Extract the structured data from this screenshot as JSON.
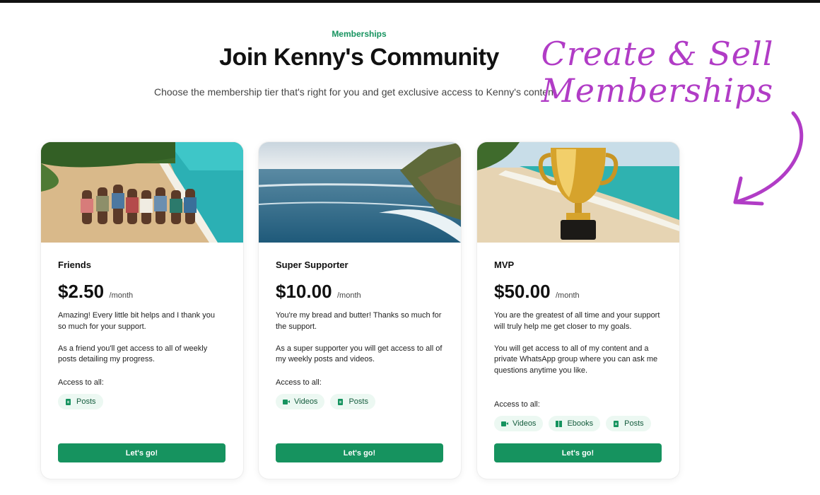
{
  "header": {
    "eyebrow": "Memberships",
    "title": "Join Kenny's Community",
    "subtitle": "Choose the membership tier that's right for you and get exclusive access to Kenny's content"
  },
  "promo": {
    "line1": "Create & Sell",
    "line2": "Memberships",
    "color": "#b13cc6"
  },
  "colors": {
    "accent": "#16935f",
    "chip_bg": "#ecf8f2",
    "chip_text": "#145c3d"
  },
  "tiers": [
    {
      "name": "Friends",
      "price": "$2.50",
      "period": "/month",
      "description": [
        "Amazing! Every little bit helps and I thank you so much for your support.",
        "As a friend you'll get access to all of weekly posts detailing my progress."
      ],
      "access_label": "Access to all:",
      "chips": [
        {
          "label": "Posts",
          "icon": "document-icon"
        }
      ],
      "cta": "Let's go!",
      "image": "group-of-friends-on-beach"
    },
    {
      "name": "Super Supporter",
      "price": "$10.00",
      "period": "/month",
      "description": [
        "You're my bread and butter! Thanks so much for the support.",
        "As a super supporter you will get access to all of my weekly posts and videos."
      ],
      "access_label": "Access to all:",
      "chips": [
        {
          "label": "Videos",
          "icon": "video-icon"
        },
        {
          "label": "Posts",
          "icon": "document-icon"
        }
      ],
      "cta": "Let's go!",
      "image": "ocean-shoreline"
    },
    {
      "name": "MVP",
      "price": "$50.00",
      "period": "/month",
      "description": [
        "You are the greatest of all time and your support will truly help me get closer to my goals.",
        "You will get access to all of my content and a private WhatsApp group where you can ask me questions anytime you like."
      ],
      "access_label": "Access to all:",
      "chips": [
        {
          "label": "Videos",
          "icon": "video-icon"
        },
        {
          "label": "Ebooks",
          "icon": "book-icon"
        },
        {
          "label": "Posts",
          "icon": "document-icon"
        }
      ],
      "cta": "Let's go!",
      "image": "gold-trophy-on-beach"
    }
  ]
}
